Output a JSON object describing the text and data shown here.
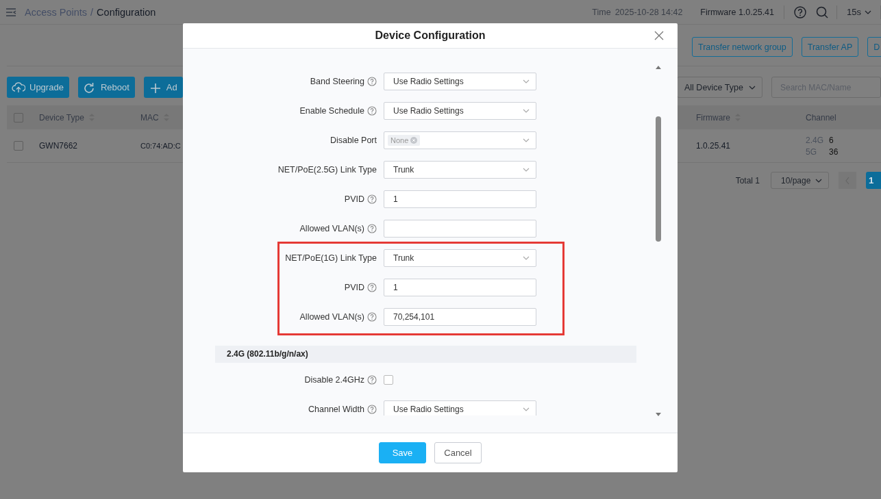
{
  "header": {
    "breadcrumb_parent": "Access Points",
    "breadcrumb_separator": "/",
    "breadcrumb_current": "Configuration",
    "time_label": "Time",
    "time": "2025-10-28 14:42",
    "firmware": "Firmware 1.0.25.41",
    "refresh": "15s"
  },
  "action_buttons": [
    "Transfer network group",
    "Transfer AP",
    "D"
  ],
  "toolbar": {
    "buttons": [
      {
        "label": "Upgrade"
      },
      {
        "label": "Reboot"
      },
      {
        "label": "Ad"
      }
    ],
    "filter": "All Device Type",
    "search": {
      "placeholder": "Search MAC/Name"
    }
  },
  "table": {
    "select_all": {
      "checked": false
    },
    "columns": [
      {
        "label": "Device Type",
        "sortable": true
      },
      {
        "label": "MAC",
        "sortable": true
      },
      {
        "label": "Firmware",
        "sortable": true
      },
      {
        "label": "Channel",
        "sortable": false
      }
    ],
    "rows": [
      {
        "checked": false,
        "device_type": "GWN7662",
        "mac": "C0:74:AD:C",
        "firmware": "1.0.25.41",
        "channels": [
          {
            "band": "2.4G",
            "value": "6"
          },
          {
            "band": "5G",
            "value": "36"
          }
        ]
      }
    ]
  },
  "pagination": {
    "total": "Total 1",
    "page_size": "10/page",
    "pages": [
      {
        "label": "1",
        "selected": true
      }
    ]
  },
  "dialog": {
    "title": "Device Configuration",
    "fields": [
      {
        "kind": "select",
        "label": "Band Steering",
        "help": true,
        "value": "Use Radio Settings"
      },
      {
        "kind": "select",
        "label": "Enable Schedule",
        "help": true,
        "value": "Use Radio Settings"
      },
      {
        "kind": "tags",
        "label": "Disable Port",
        "help": false,
        "tags": [
          "None"
        ]
      },
      {
        "kind": "select",
        "label": "NET/PoE(2.5G) Link Type",
        "help": false,
        "value": "Trunk"
      },
      {
        "kind": "input",
        "label": "PVID",
        "help": true,
        "value": "1"
      },
      {
        "kind": "input",
        "label": "Allowed VLAN(s)",
        "help": true
      }
    ],
    "highlight_box": {
      "fields": [
        {
          "kind": "select",
          "label": "NET/PoE(1G) Link Type",
          "help": false,
          "value": "Trunk"
        },
        {
          "kind": "input",
          "label": "PVID",
          "help": true,
          "value": "1"
        },
        {
          "kind": "input",
          "label": "Allowed VLAN(s)",
          "help": true,
          "value": "70,254,101"
        }
      ]
    },
    "section": {
      "title": "2.4G (802.11b/g/n/ax)",
      "fields": [
        {
          "kind": "checkbox",
          "label": "Disable 2.4GHz",
          "help": true,
          "checked": false
        },
        {
          "kind": "select",
          "label": "Channel Width",
          "help": true,
          "value": "Use Radio Settings"
        }
      ]
    },
    "buttons": [
      {
        "label": "Save",
        "kind": "primary"
      },
      {
        "label": "Cancel",
        "kind": "default"
      }
    ]
  }
}
